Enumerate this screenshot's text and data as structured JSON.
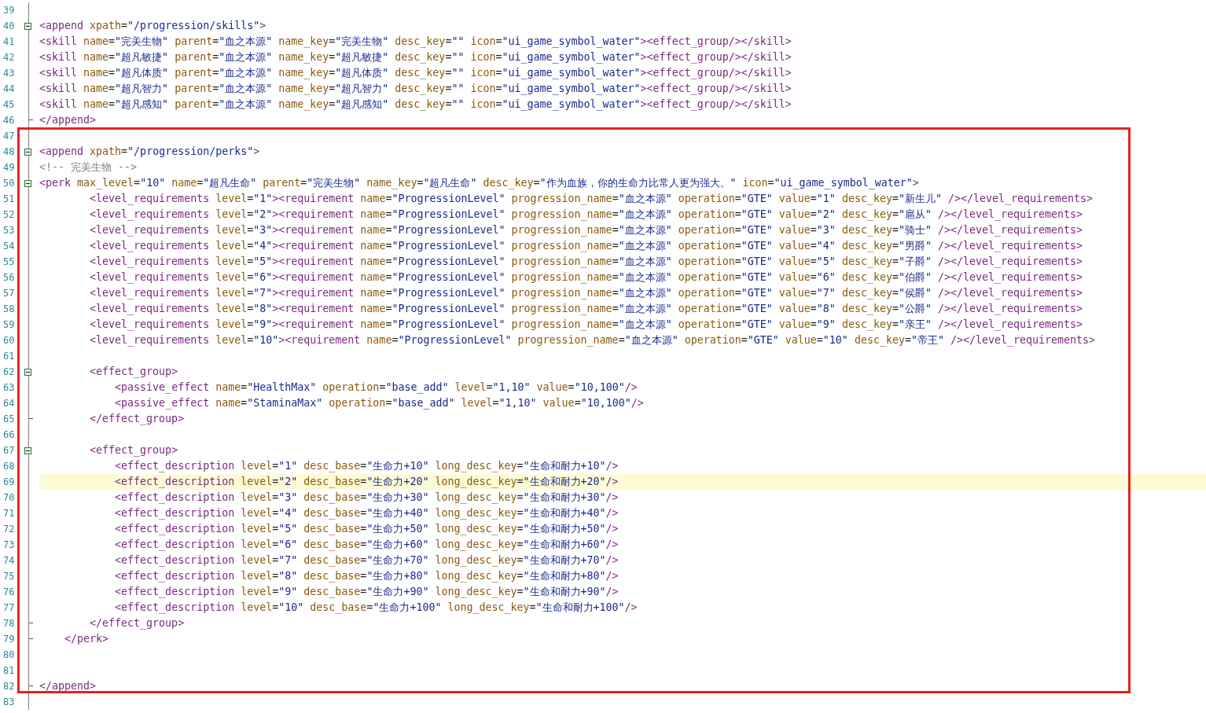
{
  "editor": {
    "sections": [
      {
        "framed": false,
        "lines": [
          {
            "number": "39",
            "kind": "plain",
            "current": false
          },
          {
            "number": "40",
            "kind": "start",
            "current": false,
            "text": "<append xpath=\"/progression/skills\">"
          },
          {
            "number": "41",
            "kind": "plain",
            "current": false,
            "text": "<skill name=\"完美生物\" parent=\"血之本源\" name_key=\"完美生物\" desc_key=\"\" icon=\"ui_game_symbol_water\"><effect_group/></skill>"
          },
          {
            "number": "42",
            "kind": "plain",
            "current": false,
            "text": "<skill name=\"超凡敏捷\" parent=\"血之本源\" name_key=\"超凡敏捷\" desc_key=\"\" icon=\"ui_game_symbol_water\"><effect_group/></skill>"
          },
          {
            "number": "43",
            "kind": "plain",
            "current": false,
            "text": "<skill name=\"超凡体质\" parent=\"血之本源\" name_key=\"超凡体质\" desc_key=\"\" icon=\"ui_game_symbol_water\"><effect_group/></skill>"
          },
          {
            "number": "44",
            "kind": "plain",
            "current": false,
            "text": "<skill name=\"超凡智力\" parent=\"血之本源\" name_key=\"超凡智力\" desc_key=\"\" icon=\"ui_game_symbol_water\"><effect_group/></skill>"
          },
          {
            "number": "45",
            "kind": "plain",
            "current": false,
            "text": "<skill name=\"超凡感知\" parent=\"血之本源\" name_key=\"超凡感知\" desc_key=\"\" icon=\"ui_game_symbol_water\"><effect_group/></skill>"
          },
          {
            "number": "46",
            "kind": "end",
            "current": false,
            "text": "</append>"
          }
        ]
      },
      {
        "framed": true,
        "lines": [
          {
            "number": "47",
            "kind": "plain",
            "current": false
          },
          {
            "number": "48",
            "kind": "start",
            "current": false,
            "text": "<append xpath=\"/progression/perks\">"
          },
          {
            "number": "49",
            "kind": "plain",
            "current": false,
            "text": "<!-- 完美生物 -->"
          },
          {
            "number": "50",
            "kind": "start",
            "current": false,
            "text": "<perk max_level=\"10\" name=\"超凡生命\" parent=\"完美生物\" name_key=\"超凡生命\" desc_key=\"作为血族，你的生命力比常人更为强大。\" icon=\"ui_game_symbol_water\">"
          },
          {
            "number": "51",
            "kind": "plain",
            "current": false,
            "text": "        <level_requirements level=\"1\"><requirement name=\"ProgressionLevel\" progression_name=\"血之本源\" operation=\"GTE\" value=\"1\" desc_key=\"新生儿\" /></level_requirements>"
          },
          {
            "number": "52",
            "kind": "plain",
            "current": false,
            "text": "        <level_requirements level=\"2\"><requirement name=\"ProgressionLevel\" progression_name=\"血之本源\" operation=\"GTE\" value=\"2\" desc_key=\"扈从\" /></level_requirements>"
          },
          {
            "number": "53",
            "kind": "plain",
            "current": false,
            "text": "        <level_requirements level=\"3\"><requirement name=\"ProgressionLevel\" progression_name=\"血之本源\" operation=\"GTE\" value=\"3\" desc_key=\"骑士\" /></level_requirements>"
          },
          {
            "number": "54",
            "kind": "plain",
            "current": false,
            "text": "        <level_requirements level=\"4\"><requirement name=\"ProgressionLevel\" progression_name=\"血之本源\" operation=\"GTE\" value=\"4\" desc_key=\"男爵\" /></level_requirements>"
          },
          {
            "number": "55",
            "kind": "plain",
            "current": false,
            "text": "        <level_requirements level=\"5\"><requirement name=\"ProgressionLevel\" progression_name=\"血之本源\" operation=\"GTE\" value=\"5\" desc_key=\"子爵\" /></level_requirements>"
          },
          {
            "number": "56",
            "kind": "plain",
            "current": false,
            "text": "        <level_requirements level=\"6\"><requirement name=\"ProgressionLevel\" progression_name=\"血之本源\" operation=\"GTE\" value=\"6\" desc_key=\"伯爵\" /></level_requirements>"
          },
          {
            "number": "57",
            "kind": "plain",
            "current": false,
            "text": "        <level_requirements level=\"7\"><requirement name=\"ProgressionLevel\" progression_name=\"血之本源\" operation=\"GTE\" value=\"7\" desc_key=\"侯爵\" /></level_requirements>"
          },
          {
            "number": "58",
            "kind": "plain",
            "current": false,
            "text": "        <level_requirements level=\"8\"><requirement name=\"ProgressionLevel\" progression_name=\"血之本源\" operation=\"GTE\" value=\"8\" desc_key=\"公爵\" /></level_requirements>"
          },
          {
            "number": "59",
            "kind": "plain",
            "current": false,
            "text": "        <level_requirements level=\"9\"><requirement name=\"ProgressionLevel\" progression_name=\"血之本源\" operation=\"GTE\" value=\"9\" desc_key=\"亲王\" /></level_requirements>"
          },
          {
            "number": "60",
            "kind": "plain",
            "current": false,
            "text": "        <level_requirements level=\"10\"><requirement name=\"ProgressionLevel\" progression_name=\"血之本源\" operation=\"GTE\" value=\"10\" desc_key=\"帝王\" /></level_requirements>"
          },
          {
            "number": "61",
            "kind": "plain",
            "current": false
          },
          {
            "number": "62",
            "kind": "start",
            "current": false,
            "text": "        <effect_group>"
          },
          {
            "number": "63",
            "kind": "plain",
            "current": false,
            "text": "            <passive_effect name=\"HealthMax\" operation=\"base_add\" level=\"1,10\" value=\"10,100\"/>"
          },
          {
            "number": "64",
            "kind": "plain",
            "current": false,
            "text": "            <passive_effect name=\"StaminaMax\" operation=\"base_add\" level=\"1,10\" value=\"10,100\"/>"
          },
          {
            "number": "65",
            "kind": "end",
            "current": false,
            "text": "        </effect_group>"
          },
          {
            "number": "66",
            "kind": "plain",
            "current": false
          },
          {
            "number": "67",
            "kind": "start",
            "current": false,
            "text": "        <effect_group>"
          },
          {
            "number": "68",
            "kind": "plain",
            "current": false,
            "text": "            <effect_description level=\"1\" desc_base=\"生命力+10\" long_desc_key=\"生命和耐力+10\"/>"
          },
          {
            "number": "69",
            "kind": "plain",
            "current": true,
            "text": "            <effect_description level=\"2\" desc_base=\"生命力+20\" long_desc_key=\"生命和耐力+20\"/>"
          },
          {
            "number": "70",
            "kind": "plain",
            "current": false,
            "text": "            <effect_description level=\"3\" desc_base=\"生命力+30\" long_desc_key=\"生命和耐力+30\"/>"
          },
          {
            "number": "71",
            "kind": "plain",
            "current": false,
            "text": "            <effect_description level=\"4\" desc_base=\"生命力+40\" long_desc_key=\"生命和耐力+40\"/>"
          },
          {
            "number": "72",
            "kind": "plain",
            "current": false,
            "text": "            <effect_description level=\"5\" desc_base=\"生命力+50\" long_desc_key=\"生命和耐力+50\"/>"
          },
          {
            "number": "73",
            "kind": "plain",
            "current": false,
            "text": "            <effect_description level=\"6\" desc_base=\"生命力+60\" long_desc_key=\"生命和耐力+60\"/>"
          },
          {
            "number": "74",
            "kind": "plain",
            "current": false,
            "text": "            <effect_description level=\"7\" desc_base=\"生命力+70\" long_desc_key=\"生命和耐力+70\"/>"
          },
          {
            "number": "75",
            "kind": "plain",
            "current": false,
            "text": "            <effect_description level=\"8\" desc_base=\"生命力+80\" long_desc_key=\"生命和耐力+80\"/>"
          },
          {
            "number": "76",
            "kind": "plain",
            "current": false,
            "text": "            <effect_description level=\"9\" desc_base=\"生命力+90\" long_desc_key=\"生命和耐力+90\"/>"
          },
          {
            "number": "77",
            "kind": "plain",
            "current": false,
            "text": "            <effect_description level=\"10\" desc_base=\"生命力+100\" long_desc_key=\"生命和耐力+100\"/>"
          },
          {
            "number": "78",
            "kind": "end",
            "current": false,
            "text": "        </effect_group>"
          },
          {
            "number": "79",
            "kind": "end",
            "current": false,
            "text": "    </perk>"
          },
          {
            "number": "80",
            "kind": "plain",
            "current": false
          },
          {
            "number": "81",
            "kind": "plain",
            "current": false
          },
          {
            "number": "82",
            "kind": "end",
            "current": false,
            "text": "</append>"
          }
        ]
      },
      {
        "framed": false,
        "lines": [
          {
            "number": "83",
            "kind": "plain",
            "current": false
          }
        ]
      }
    ]
  }
}
